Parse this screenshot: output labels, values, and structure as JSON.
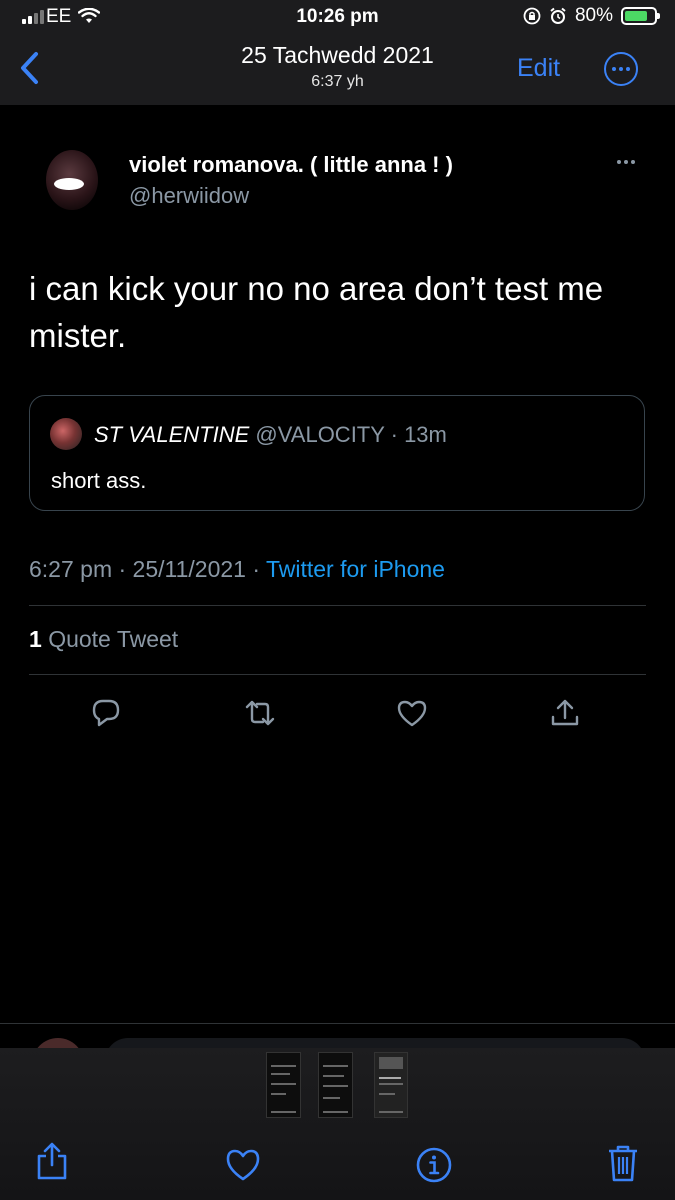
{
  "status_bar": {
    "carrier": "EE",
    "time": "10:26 pm",
    "battery": "80%",
    "battery_level": 0.8
  },
  "photos_header": {
    "title": "25 Tachwedd 2021",
    "subtitle": "6:37 yh",
    "edit_label": "Edit"
  },
  "tweet": {
    "display_name": "violet romanova. ( little anna ! )",
    "handle": "@herwiidow",
    "text": "i can kick your no no area don’t test me mister.",
    "timestamp": "6:27 pm · 25/11/2021 ·",
    "source": "Twitter for iPhone",
    "quote_count": "1",
    "quote_label": "Quote Tweet"
  },
  "quoted_tweet": {
    "display_name": "ST VALENTINE",
    "meta": "@VALOCITY · 13m",
    "text": "short ass."
  },
  "icons": {
    "actions": [
      "reply-icon",
      "retweet-icon",
      "like-icon",
      "share-icon"
    ],
    "toolbar": [
      "share-icon",
      "favorite-icon",
      "info-icon",
      "trash-icon"
    ]
  },
  "colors": {
    "accent_blue": "#3b82f6",
    "twitter_blue": "#1d9bf0",
    "secondary_text": "#8b98a5",
    "battery_green": "#4cd964"
  }
}
